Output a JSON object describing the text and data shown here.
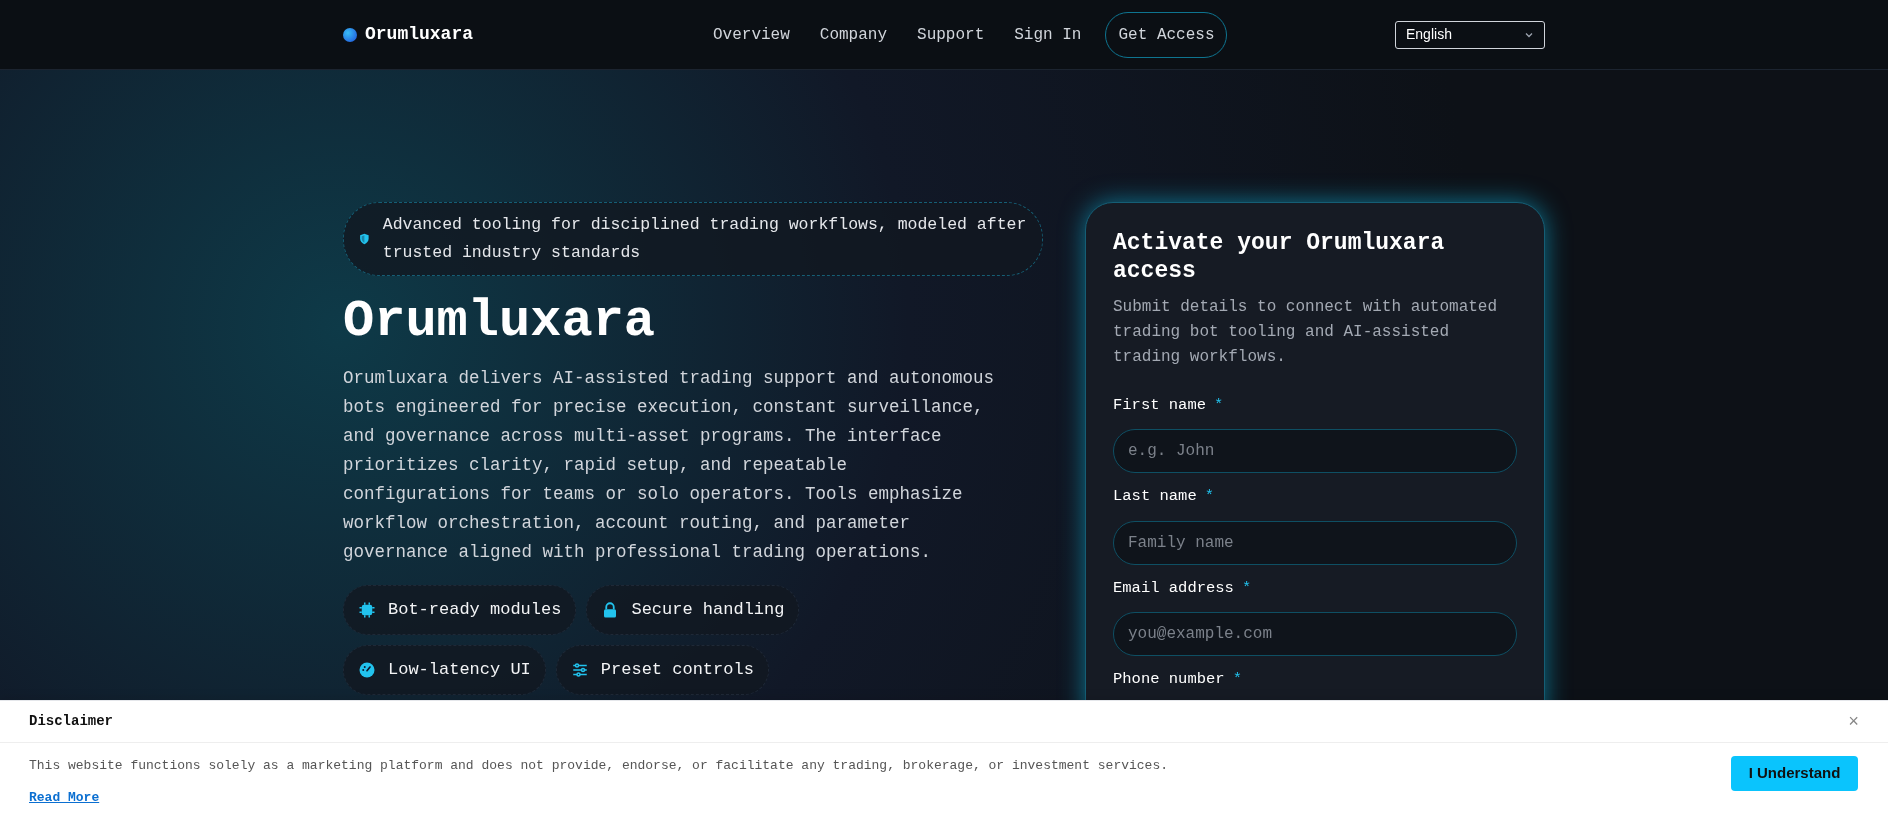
{
  "header": {
    "brand": "Orumluxara",
    "nav": [
      {
        "label": "Overview",
        "kind": "link"
      },
      {
        "label": "Company",
        "kind": "link"
      },
      {
        "label": "Support",
        "kind": "link"
      },
      {
        "label": "Sign In",
        "kind": "link"
      },
      {
        "label": "Get Access",
        "kind": "outlined"
      }
    ],
    "language": "English"
  },
  "hero": {
    "banner": "Advanced tooling for disciplined trading workflows, modeled after trusted industry standards",
    "title": "Orumluxara",
    "description": "Orumluxara delivers AI-assisted trading support and autonomous bots engineered for precise execution, constant surveillance, and governance across multi-asset programs. The interface prioritizes clarity, rapid setup, and repeatable configurations for teams or solo operators. Tools emphasize workflow orchestration, account routing, and parameter governance aligned with professional trading operations.",
    "features": [
      {
        "label": "Bot-ready modules",
        "kind": "chip"
      },
      {
        "label": "Secure handling",
        "kind": "lock"
      },
      {
        "label": "Low-latency UI",
        "kind": "gauge"
      },
      {
        "label": "Preset controls",
        "kind": "sliders"
      }
    ]
  },
  "form": {
    "title": "Activate your Orumluxara access",
    "subtitle": "Submit details to connect with automated trading bot tooling and AI-assisted trading workflows.",
    "fields": [
      {
        "label": "First name",
        "required": "*",
        "placeholder": "e.g. John"
      },
      {
        "label": "Last name",
        "required": "*",
        "placeholder": "Family name"
      },
      {
        "label": "Email address",
        "required": "*",
        "placeholder": "you@example.com"
      },
      {
        "label": "Phone number",
        "required": "*"
      }
    ]
  },
  "disclaimer": {
    "title": "Disclaimer",
    "close": "×",
    "text": "This website functions solely as a marketing platform and does not provide, endorse, or facilitate any trading, brokerage, or investment services.",
    "link": "Read More",
    "button": "I Understand"
  }
}
